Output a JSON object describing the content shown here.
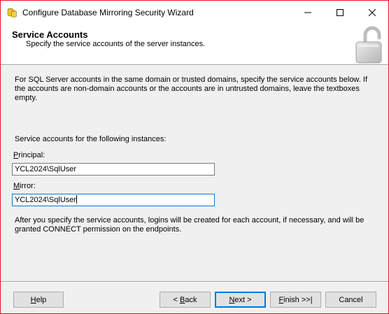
{
  "window": {
    "title": "Configure Database Mirroring Security Wizard"
  },
  "header": {
    "title": "Service Accounts",
    "subtitle": "Specify the service accounts of the server instances."
  },
  "body": {
    "description": "For SQL Server accounts in the same domain or trusted domains, specify the service accounts below. If the accounts are non-domain accounts or the accounts are in untrusted domains, leave the textboxes empty.",
    "instances_label": "Service accounts for the following instances:",
    "principal_label_mnemonic": "P",
    "principal_label_rest": "rincipal:",
    "principal_value": "YCL2024\\SqlUser",
    "mirror_label_mnemonic": "M",
    "mirror_label_rest": "irror:",
    "mirror_value": "YCL2024\\SqlUser",
    "info": "After you specify the service accounts, logins will be created for each account, if necessary, and will be granted CONNECT permission on the endpoints."
  },
  "buttons": {
    "help_mn": "H",
    "help_rest": "elp",
    "back_pre": "< ",
    "back_mn": "B",
    "back_rest": "ack",
    "next_mn": "N",
    "next_rest": "ext >",
    "finish_mn": "F",
    "finish_rest": "inish >>|",
    "cancel": "Cancel"
  },
  "colors": {
    "window_border": "#e81123",
    "focus_accent": "#0078d7"
  },
  "icons": {
    "app": "database-icon",
    "header": "padlock-icon"
  }
}
